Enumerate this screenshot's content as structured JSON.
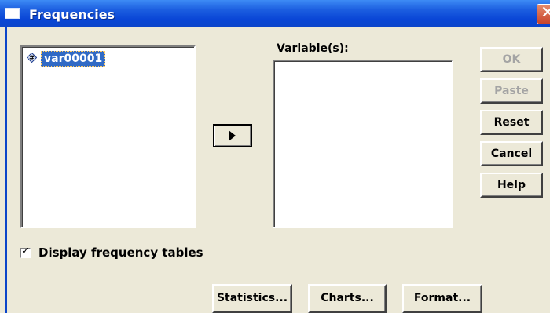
{
  "window": {
    "title": "Frequencies",
    "close_glyph": "✕"
  },
  "source_list": {
    "items": [
      {
        "label": "var00001",
        "icon": "scale-variable-icon"
      }
    ]
  },
  "target_list": {
    "label": "Variable(s):",
    "items": []
  },
  "buttons": {
    "ok": "OK",
    "paste": "Paste",
    "reset": "Reset",
    "cancel": "Cancel",
    "help": "Help",
    "statistics": "Statistics...",
    "charts": "Charts...",
    "format": "Format..."
  },
  "options": {
    "display_frequency_tables": {
      "label": "Display frequency tables",
      "checked": true,
      "mark": "✓"
    }
  },
  "colors": {
    "titlebar": "#0a46d6",
    "selection": "#316ac5",
    "dialog": "#ece9d8"
  }
}
